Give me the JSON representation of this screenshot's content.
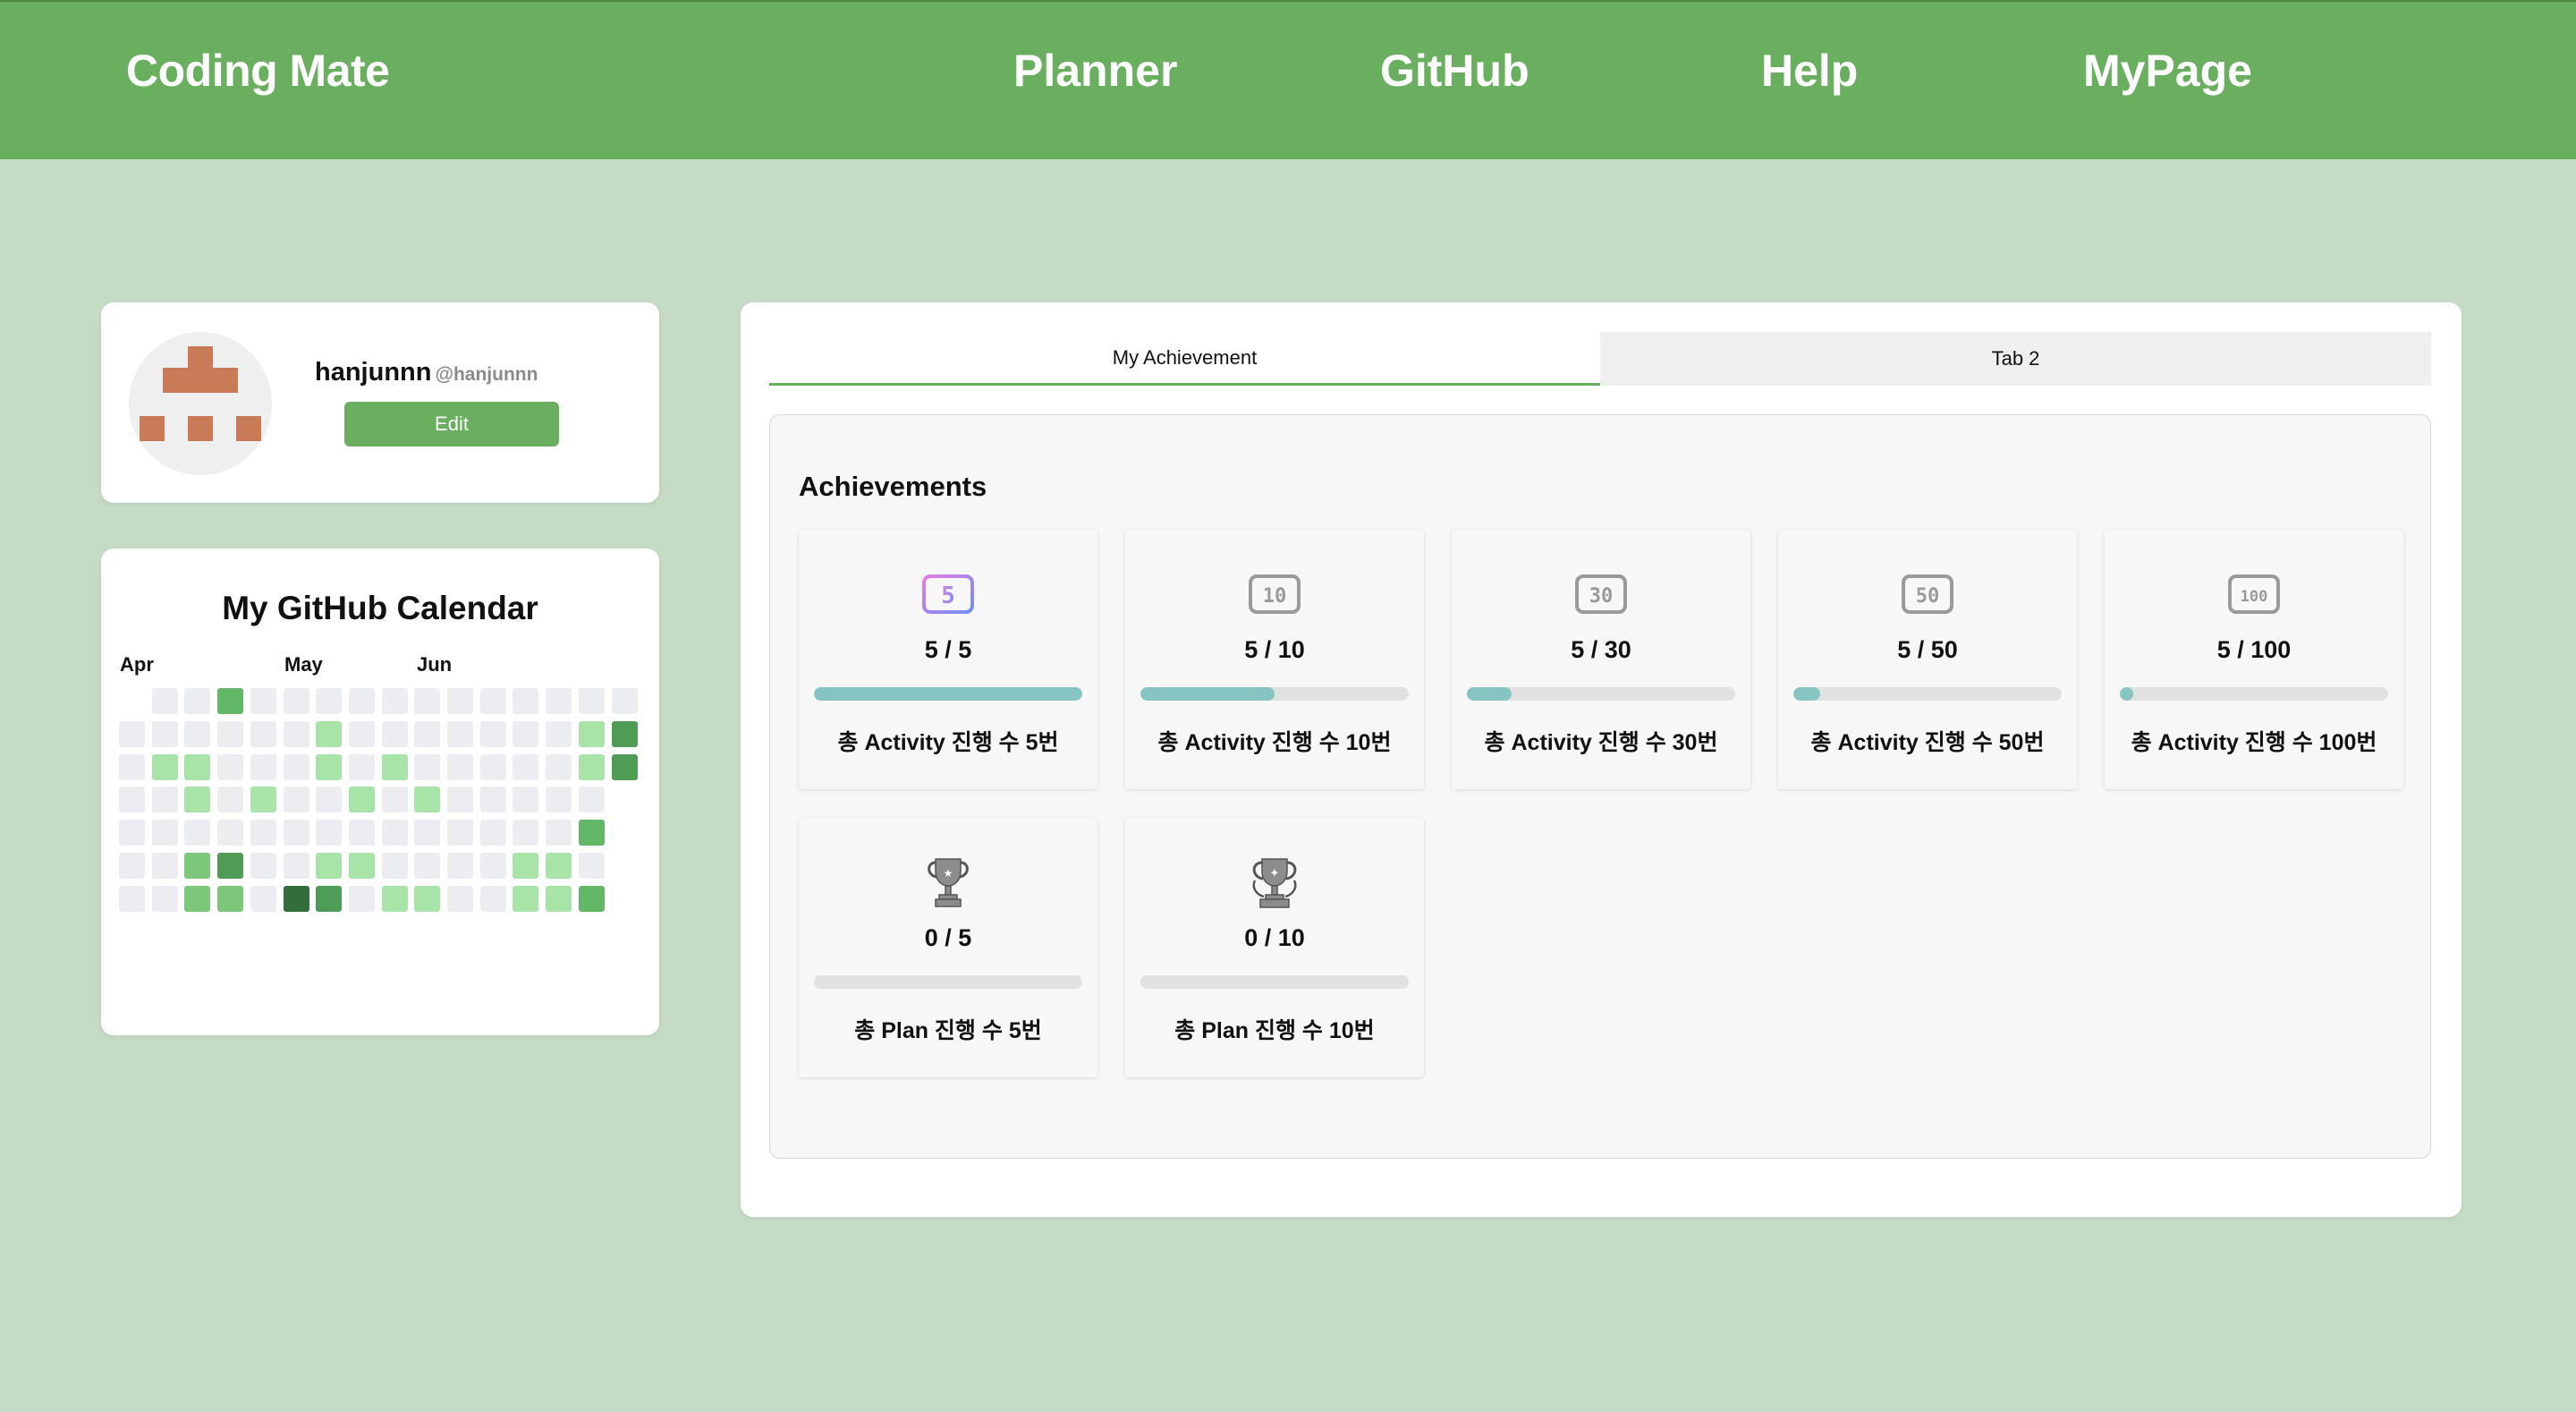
{
  "header": {
    "brand": "Coding Mate",
    "nav": [
      "Planner",
      "GitHub",
      "Help",
      "MyPage"
    ],
    "color": "#69af5f"
  },
  "profile": {
    "username": "hanjunnn",
    "handle": "@hanjunnn",
    "edit_label": "Edit",
    "avatar_color": "#c97b57"
  },
  "calendar": {
    "title": "My GitHub Calendar",
    "months": [
      "Apr",
      "May",
      "Jun"
    ],
    "levels": [
      [
        -1,
        0,
        0,
        3,
        0,
        0,
        0,
        0,
        0,
        0,
        0,
        0,
        0,
        0,
        0,
        0
      ],
      [
        0,
        0,
        0,
        0,
        0,
        0,
        1,
        0,
        0,
        0,
        0,
        0,
        0,
        0,
        1,
        4
      ],
      [
        0,
        1,
        1,
        0,
        0,
        0,
        1,
        0,
        1,
        0,
        0,
        0,
        0,
        0,
        1,
        4
      ],
      [
        0,
        0,
        1,
        0,
        1,
        0,
        0,
        1,
        0,
        1,
        0,
        0,
        0,
        0,
        0,
        -1
      ],
      [
        0,
        0,
        0,
        0,
        0,
        0,
        0,
        0,
        0,
        0,
        0,
        0,
        0,
        0,
        3,
        -1
      ],
      [
        0,
        0,
        2,
        4,
        0,
        0,
        1,
        1,
        0,
        0,
        0,
        0,
        1,
        1,
        0,
        -1
      ],
      [
        0,
        0,
        2,
        2,
        0,
        5,
        4,
        0,
        1,
        1,
        0,
        0,
        1,
        1,
        3,
        -1
      ]
    ],
    "colors": [
      "#ebedf0",
      "#a8e3a8",
      "#7bc87b",
      "#63b867",
      "#4e9c56",
      "#336d3c"
    ]
  },
  "tabs": [
    "My Achievement",
    "Tab 2"
  ],
  "achievements": {
    "heading": "Achievements",
    "items": [
      {
        "icon": "badge-5-icon",
        "badge": "5",
        "count": "5 / 5",
        "progress": 1.0,
        "label": "총 Activity 진행 수 5번"
      },
      {
        "icon": "badge-10-icon",
        "badge": "10",
        "count": "5 / 10",
        "progress": 0.5,
        "label": "총 Activity 진행 수 10번"
      },
      {
        "icon": "badge-30-icon",
        "badge": "30",
        "count": "5 / 30",
        "progress": 0.1667,
        "label": "총 Activity 진행 수 30번"
      },
      {
        "icon": "badge-50-icon",
        "badge": "50",
        "count": "5 / 50",
        "progress": 0.1,
        "label": "총 Activity 진행 수 50번"
      },
      {
        "icon": "badge-100-icon",
        "badge": "100",
        "count": "5 / 100",
        "progress": 0.05,
        "label": "총 Activity 진행 수 100번"
      },
      {
        "icon": "trophy-icon",
        "badge": "",
        "count": "0 / 5",
        "progress": 0,
        "label": "총 Plan 진행 수 5번"
      },
      {
        "icon": "trophy-laurel-icon",
        "badge": "",
        "count": "0 / 10",
        "progress": 0,
        "label": "총 Plan 진행 수 10번"
      }
    ]
  }
}
